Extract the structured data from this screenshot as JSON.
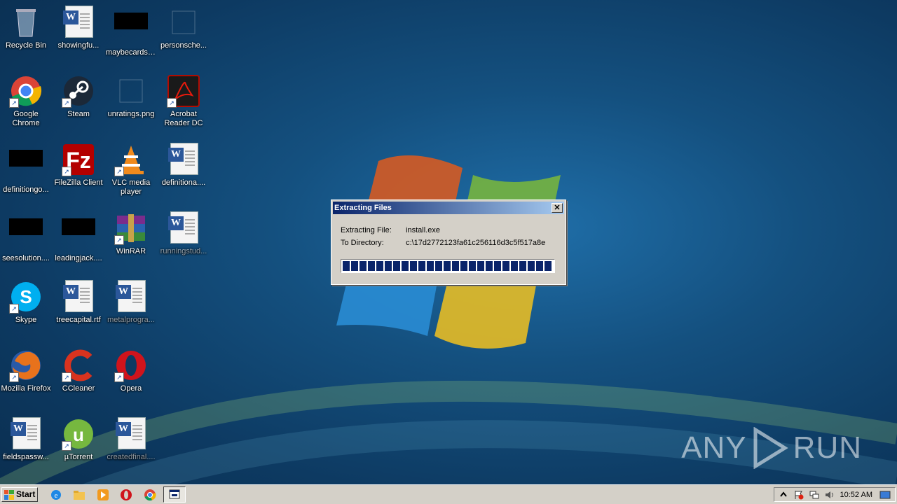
{
  "desktop": {
    "icons": [
      {
        "label": "Recycle Bin",
        "icon": "recycle-bin-icon"
      },
      {
        "label": "Google Chrome",
        "icon": "chrome-icon"
      },
      {
        "label": "definitiongo...",
        "icon": "black-file-icon"
      },
      {
        "label": "seesolution....",
        "icon": "black-file-icon"
      },
      {
        "label": "Skype",
        "icon": "skype-icon"
      },
      {
        "label": "Mozilla Firefox",
        "icon": "firefox-icon"
      },
      {
        "label": "fieldspassw...",
        "icon": "word-doc-icon"
      },
      {
        "label": "showingfu...",
        "icon": "word-doc-icon"
      },
      {
        "label": "Steam",
        "icon": "steam-icon"
      },
      {
        "label": "FileZilla Client",
        "icon": "filezilla-icon"
      },
      {
        "label": "leadingjack....",
        "icon": "black-file-icon"
      },
      {
        "label": "treecapital.rtf",
        "icon": "word-doc-icon"
      },
      {
        "label": "CCleaner",
        "icon": "ccleaner-icon"
      },
      {
        "label": "µTorrent",
        "icon": "utorrent-icon"
      },
      {
        "label": "maybecards....",
        "icon": "black-file-icon"
      },
      {
        "label": "unratings.png",
        "icon": "image-file-icon"
      },
      {
        "label": "VLC media player",
        "icon": "vlc-icon"
      },
      {
        "label": "WinRAR",
        "icon": "winrar-icon"
      },
      {
        "label": "metalprogra...",
        "icon": "word-doc-icon"
      },
      {
        "label": "Opera",
        "icon": "opera-icon"
      },
      {
        "label": "createdfinal....",
        "icon": "word-doc-icon"
      },
      {
        "label": "personsche...",
        "icon": "blank-file-icon"
      },
      {
        "label": "Acrobat Reader DC",
        "icon": "acrobat-icon"
      },
      {
        "label": "definitiona....",
        "icon": "word-doc-icon"
      },
      {
        "label": "runningstud...",
        "icon": "word-doc-icon"
      }
    ]
  },
  "dialog": {
    "title": "Extracting Files",
    "close_label": "✕",
    "file_key": "Extracting File:",
    "file_value": "install.exe",
    "dir_key": "To Directory:",
    "dir_value": "c:\\17d2772123fa61c256116d3c5f517a8e",
    "progress": 1.0
  },
  "watermark": {
    "left": "ANY",
    "right": "RUN"
  },
  "taskbar": {
    "start_label": "Start",
    "pinned": [
      "internet-explorer-icon",
      "explorer-folder-icon",
      "media-player-icon",
      "opera-icon",
      "chrome-icon",
      "extractor-app-icon"
    ],
    "clock": "10:52 AM"
  }
}
